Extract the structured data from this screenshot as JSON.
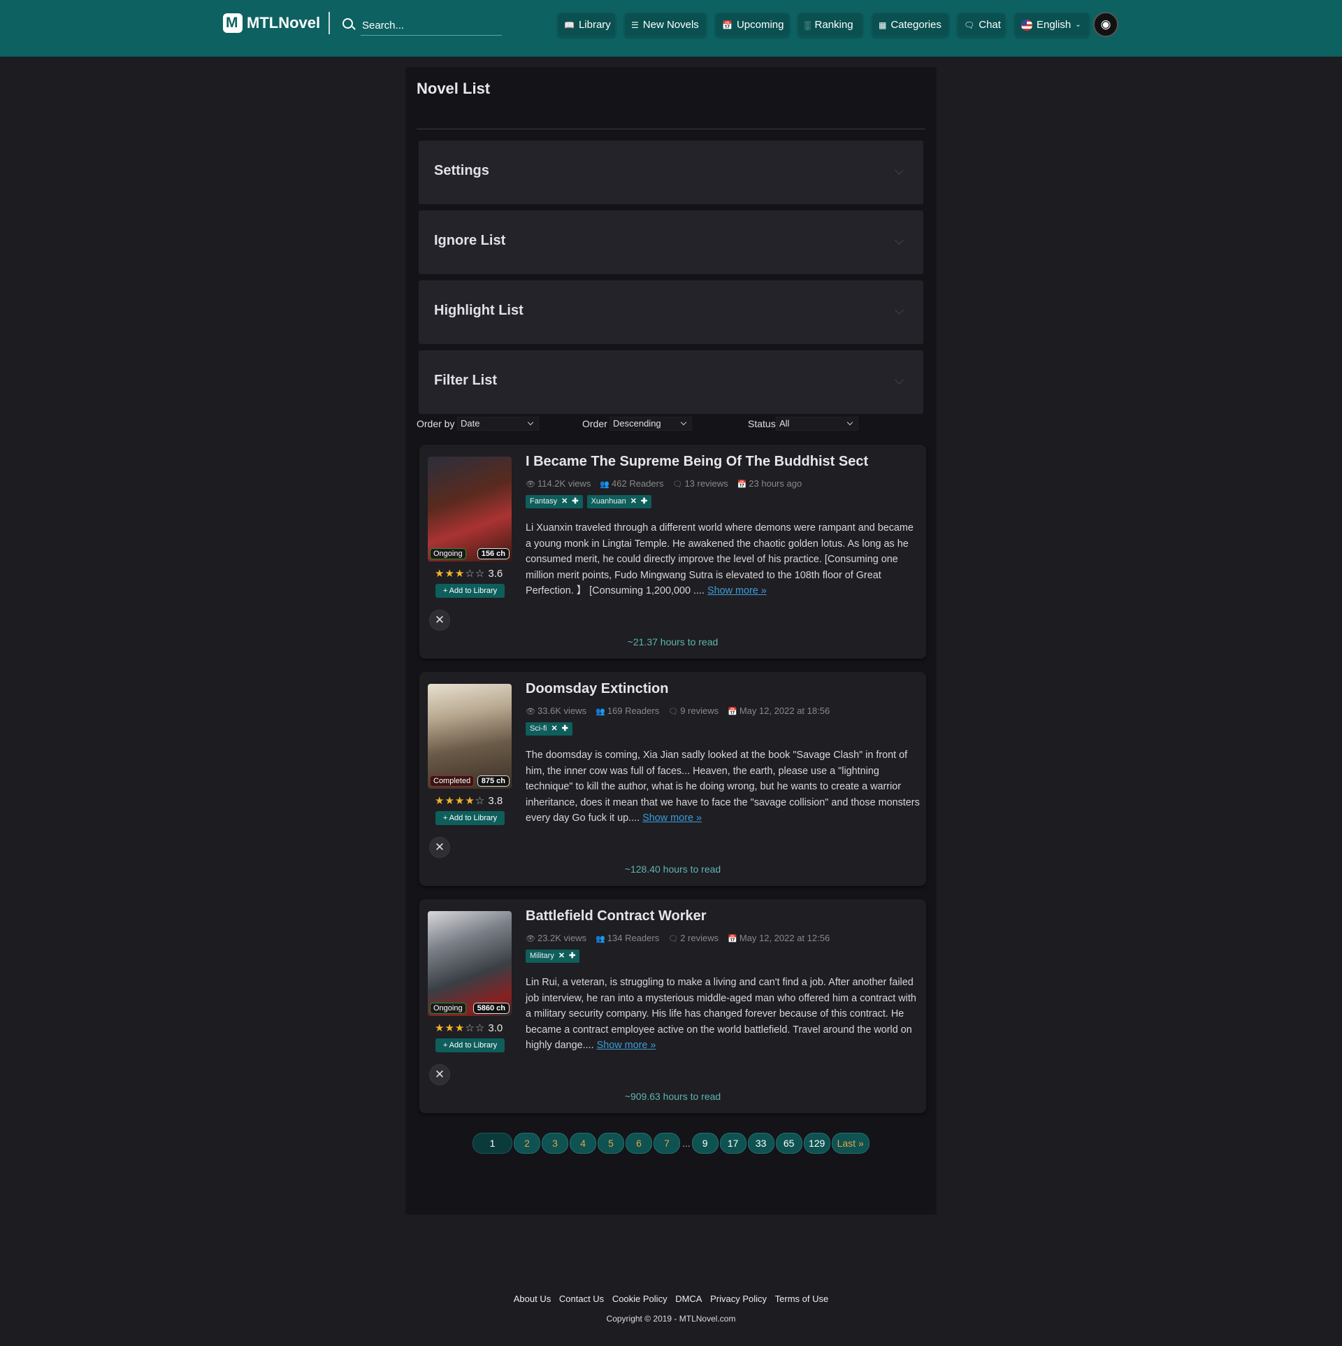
{
  "header": {
    "brand": "MTLNovel",
    "search_placeholder": "Search...",
    "nav": [
      {
        "label": "Library",
        "icon": "book-icon"
      },
      {
        "label": "New Novels",
        "icon": "list-icon"
      },
      {
        "label": "Upcoming",
        "icon": "calendar-icon"
      },
      {
        "label": "Ranking",
        "icon": "bar-chart-icon"
      },
      {
        "label": "Categories",
        "icon": "grid-icon"
      },
      {
        "label": "Chat",
        "icon": "chat-icon"
      },
      {
        "label": "English",
        "icon": "us-flag-icon"
      }
    ],
    "accent_color": "#0e6161"
  },
  "main": {
    "title": "Novel List",
    "accordions": [
      "Settings",
      "Ignore List",
      "Highlight List",
      "Filter List"
    ],
    "filters": {
      "order_by_label": "Order by",
      "order_by_value": "Date",
      "order_label": "Order",
      "order_value": "Descending",
      "status_label": "Status",
      "status_value": "All"
    },
    "novels": [
      {
        "title": "I Became The Supreme Being Of The Buddhist Sect",
        "views": "114.2K views",
        "readers": "462 Readers",
        "reviews": "13 reviews",
        "date": "23 hours ago",
        "tags": [
          "Fantasy",
          "Xuanhuan"
        ],
        "status": "Ongoing",
        "chapters": "156 ch",
        "rating": "3.6",
        "rating_value": 3.6,
        "add_label": "+ Add to Library",
        "description": "Li Xuanxin traveled through a different world where demons were rampant and became a young monk in Lingtai Temple. He awakened the chaotic golden lotus. As long as he consumed merit, he could directly improve the level of his practice. [Consuming one million merit points, Fudo Mingwang Sutra is elevated to the 108th floor of Great Perfection. 】 [Consuming 1,200,000 ....",
        "show_more": "Show more »",
        "read_time": "~21.37 hours to read"
      },
      {
        "title": "Doomsday Extinction",
        "views": "33.6K views",
        "readers": "169 Readers",
        "reviews": "9 reviews",
        "date": "May 12, 2022 at 18:56",
        "tags": [
          "Sci-fi"
        ],
        "status": "Completed",
        "chapters": "875 ch",
        "rating": "3.8",
        "rating_value": 3.8,
        "add_label": "+ Add to Library",
        "description": "The doomsday is coming, Xia Jian sadly looked at the book \"Savage Clash\" in front of him, the inner cow was full of faces... Heaven, the earth, please use a \"lightning technique\" to kill the author, what is he doing wrong, but he wants to create a warrior inheritance, does it mean that we have to face the \"savage collision\" and those monsters every day Go fuck it up....",
        "show_more": "Show more »",
        "read_time": "~128.40 hours to read"
      },
      {
        "title": "Battlefield Contract Worker",
        "views": "23.2K views",
        "readers": "134 Readers",
        "reviews": "2 reviews",
        "date": "May 12, 2022 at 12:56",
        "tags": [
          "Military"
        ],
        "status": "Ongoing",
        "chapters": "5860 ch",
        "rating": "3.0",
        "rating_value": 3.0,
        "add_label": "+ Add to Library",
        "description": "Lin Rui, a veteran, is struggling to make a living and can't find a job. After another failed job interview, he ran into a mysterious middle-aged man who offered him a contract with a military security company. His life has changed forever because of this contract. He became a contract employee active on the world battlefield. Travel around the world on highly dange....",
        "show_more": "Show more »",
        "read_time": "~909.63 hours to read"
      }
    ],
    "pagination": [
      "1",
      "2",
      "3",
      "4",
      "5",
      "6",
      "7",
      "...",
      "9",
      "17",
      "33",
      "65",
      "129",
      "Last »"
    ]
  },
  "footer": {
    "links": [
      "About Us",
      "Contact Us",
      "Cookie Policy",
      "DMCA",
      "Privacy Policy",
      "Terms of Use"
    ],
    "copyright": "Copyright © 2019 - MTLNovel.com"
  }
}
